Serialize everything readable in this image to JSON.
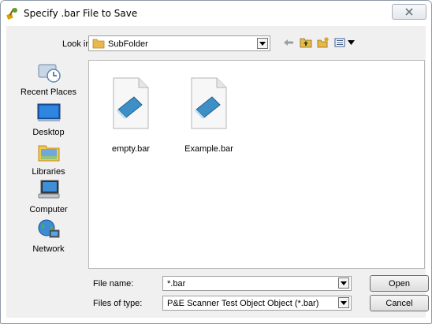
{
  "window": {
    "title": "Specify .bar File to Save",
    "icons": {
      "app": "shovel-app-icon",
      "close": "close-x-icon"
    }
  },
  "lookin": {
    "label": "Look in:",
    "value": "SubFolder",
    "folder_icon": "folder-icon"
  },
  "toolbar": {
    "icons": [
      "back-arrow-icon",
      "up-folder-icon",
      "new-folder-icon",
      "view-menu-icon"
    ]
  },
  "places": [
    {
      "label": "Recent Places",
      "icon": "recent-places-icon"
    },
    {
      "label": "Desktop",
      "icon": "desktop-icon"
    },
    {
      "label": "Libraries",
      "icon": "libraries-icon"
    },
    {
      "label": "Computer",
      "icon": "computer-icon"
    },
    {
      "label": "Network",
      "icon": "network-icon"
    }
  ],
  "files": [
    {
      "name": "empty.bar",
      "icon": "notepad-file-icon"
    },
    {
      "name": "Example.bar",
      "icon": "notepad-file-icon"
    }
  ],
  "filename": {
    "label": "File name:",
    "value": "*.bar"
  },
  "filetype": {
    "label": "Files of type:",
    "value": "P&E Scanner Test Object Object (*.bar)"
  },
  "buttons": {
    "open": "Open",
    "cancel": "Cancel"
  },
  "colors": {
    "dialog_bg": "#f0f0f0",
    "folder": "#e8b94a",
    "file_blue": "#3f8fc7"
  }
}
